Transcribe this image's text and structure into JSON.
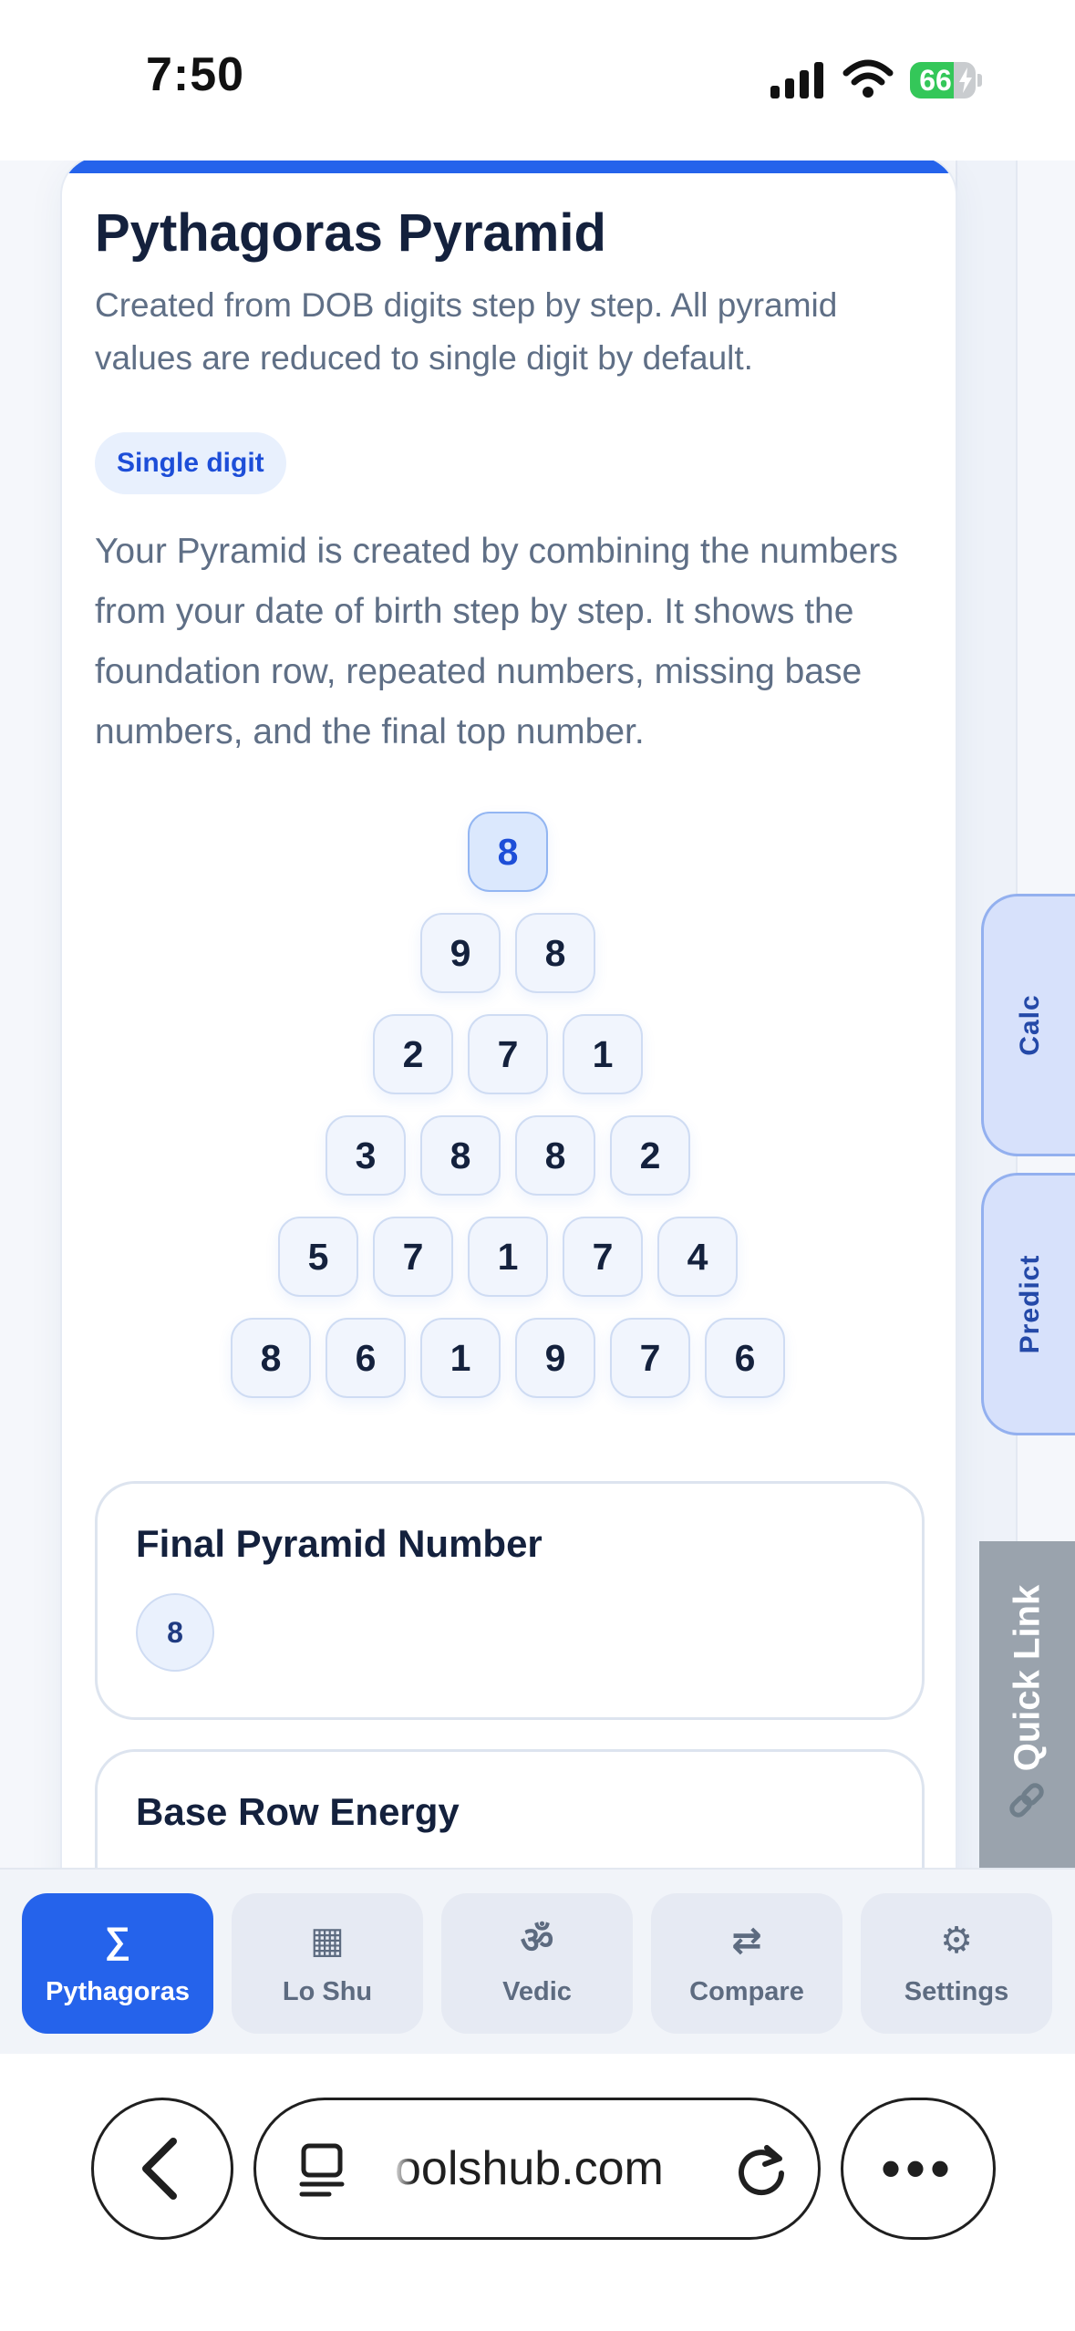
{
  "status_bar": {
    "time": "7:50",
    "battery": "66",
    "battery_level": 0.66
  },
  "card": {
    "title": "Pythagoras Pyramid",
    "subtitle": "Created from DOB digits step by step. All pyramid values are reduced to single digit by default.",
    "pill": "Single digit",
    "description": "Your Pyramid is created by combining the numbers from your date of birth step by step. It shows the foundation row, repeated numbers, missing base numbers, and the final top number."
  },
  "pyramid": {
    "rows": [
      [
        "8"
      ],
      [
        "9",
        "8"
      ],
      [
        "2",
        "7",
        "1"
      ],
      [
        "3",
        "8",
        "8",
        "2"
      ],
      [
        "5",
        "7",
        "1",
        "7",
        "4"
      ],
      [
        "8",
        "6",
        "1",
        "9",
        "7",
        "6"
      ]
    ]
  },
  "final_pyramid": {
    "title": "Final Pyramid Number",
    "value": "8"
  },
  "base_row": {
    "title": "Base Row Energy"
  },
  "side_tabs": {
    "calc": "Calc",
    "predict": "Predict",
    "quick_link": "Quick Link"
  },
  "bottom_nav": {
    "items": [
      {
        "icon": "∑",
        "label": "Pythagoras",
        "active": true
      },
      {
        "icon": "▦",
        "label": "Lo Shu",
        "active": false
      },
      {
        "icon": "ॐ",
        "label": "Vedic",
        "active": false
      },
      {
        "icon": "⇄",
        "label": "Compare",
        "active": false
      },
      {
        "icon": "⚙",
        "label": "Settings",
        "active": false
      }
    ]
  },
  "browser": {
    "url": "oolshub.com"
  },
  "colors": {
    "accent": "#2563eb",
    "pill_bg": "#e8f0fd",
    "side_tab_bg": "#d7e1fb",
    "quick_link_bg": "#9aa3ad"
  }
}
